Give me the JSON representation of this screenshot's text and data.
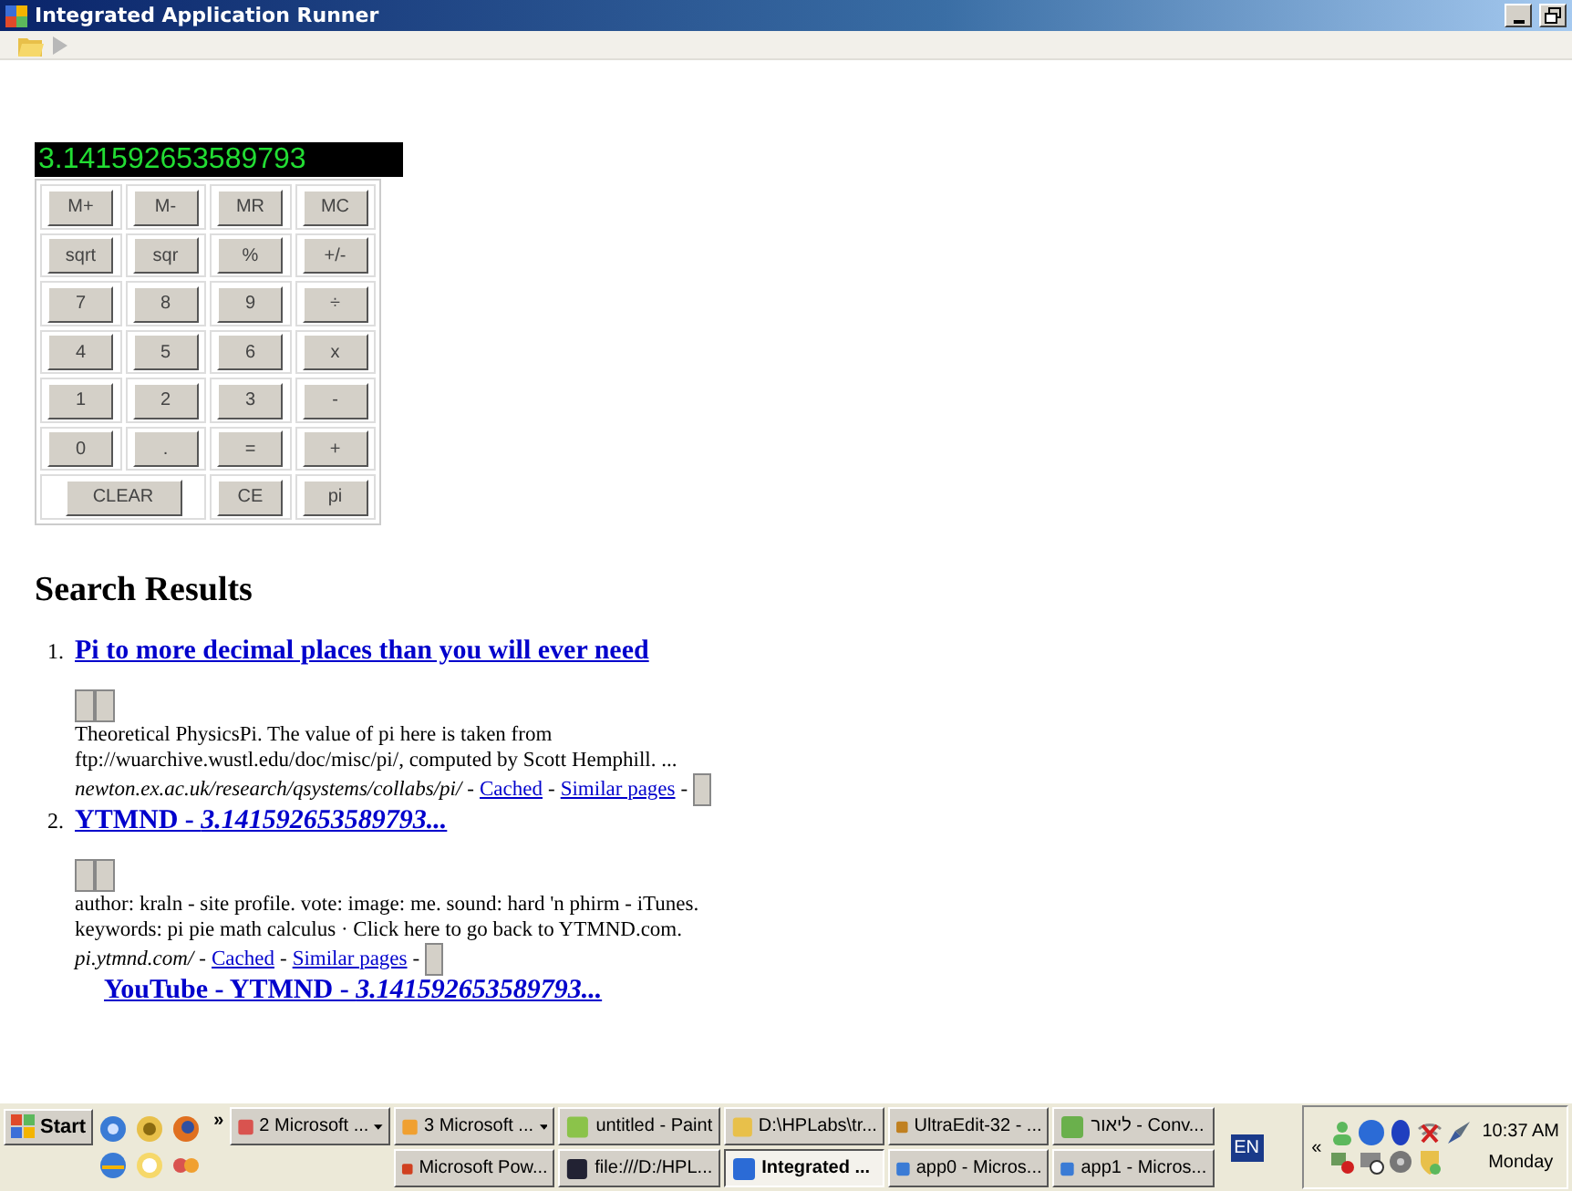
{
  "window": {
    "title": "Integrated Application Runner"
  },
  "calculator": {
    "display": "3.141592653589793",
    "rows": [
      [
        {
          "label": "M+",
          "kind": "key"
        },
        {
          "label": "M-",
          "kind": "key"
        },
        {
          "label": "MR",
          "kind": "key"
        },
        {
          "label": "MC",
          "kind": "key"
        }
      ],
      [
        {
          "label": "sqrt",
          "kind": "key"
        },
        {
          "label": "sqr",
          "kind": "key"
        },
        {
          "label": "%",
          "kind": "key"
        },
        {
          "label": "+/-",
          "kind": "key"
        }
      ],
      [
        {
          "label": "7",
          "kind": "key"
        },
        {
          "label": "8",
          "kind": "key"
        },
        {
          "label": "9",
          "kind": "key"
        },
        {
          "label": "÷",
          "kind": "key"
        }
      ],
      [
        {
          "label": "4",
          "kind": "key"
        },
        {
          "label": "5",
          "kind": "key"
        },
        {
          "label": "6",
          "kind": "key"
        },
        {
          "label": "x",
          "kind": "key"
        }
      ],
      [
        {
          "label": "1",
          "kind": "key"
        },
        {
          "label": "2",
          "kind": "key"
        },
        {
          "label": "3",
          "kind": "key"
        },
        {
          "label": "-",
          "kind": "key"
        }
      ],
      [
        {
          "label": "0",
          "kind": "key"
        },
        {
          "label": ".",
          "kind": "key"
        },
        {
          "label": "=",
          "kind": "key"
        },
        {
          "label": "+",
          "kind": "key"
        }
      ],
      [
        {
          "label": "CLEAR",
          "kind": "wide",
          "colspan": 2
        },
        {
          "label": "CE",
          "kind": "key"
        },
        {
          "label": "pi",
          "kind": "key"
        }
      ]
    ]
  },
  "search": {
    "heading": "Search Results",
    "results": [
      {
        "number": "1.",
        "title": "Pi to more decimal places than you will ever need",
        "snippet": "Theoretical PhysicsPi. The value of pi here is taken from ftp://wuarchive.wustl.edu/doc/misc/pi/, computed by Scott Hemphill. ...",
        "url": "newton.ex.ac.uk/research/qsystems/collabs/pi/",
        "meta": [
          {
            "kind": "dash",
            "text": "-"
          },
          {
            "kind": "link",
            "text": "Cached"
          },
          {
            "kind": "dash",
            "text": "-"
          },
          {
            "kind": "link",
            "text": "Similar pages"
          },
          {
            "kind": "dash",
            "text": "-"
          }
        ]
      },
      {
        "number": "2.",
        "title": "YTMND - *3.141592653589793...*",
        "snippet": "author: kraln - site profile. vote: image: me. sound: hard 'n phirm - iTunes. keywords: pi pie math calculus · Click here to go back to YTMND.com.",
        "url": "pi.ytmnd.com/",
        "meta": [
          {
            "kind": "dash",
            "text": "-"
          },
          {
            "kind": "link",
            "text": "Cached"
          },
          {
            "kind": "dash",
            "text": "-"
          },
          {
            "kind": "link",
            "text": "Similar pages"
          },
          {
            "kind": "dash",
            "text": "-"
          }
        ]
      },
      {
        "title": "YouTube - YTMND - *3.141592653589793...*"
      }
    ]
  },
  "taskbar": {
    "start": "Start",
    "more": "»",
    "tasks": [
      {
        "label": "2 Microsoft ...",
        "kind": "group",
        "selected": false
      },
      {
        "label": "3 Microsoft ...",
        "kind": "group",
        "selected": false
      },
      {
        "label": "untitled - Paint",
        "kind": "window",
        "selected": false
      },
      {
        "label": "D:\\HPLabs\\tr...",
        "kind": "window",
        "selected": false
      },
      {
        "label": "UltraEdit-32 - ...",
        "kind": "window",
        "selected": false
      },
      {
        "label": "ליאור - Conv...",
        "kind": "window",
        "selected": false
      },
      {
        "label": "Microsoft Pow...",
        "kind": "window",
        "selected": false
      },
      {
        "label": "file:///D:/HPL...",
        "kind": "window",
        "selected": false
      },
      {
        "label": "Integrated ...",
        "kind": "window",
        "selected": true
      },
      {
        "label": "app0 - Micros...",
        "kind": "window",
        "selected": false
      },
      {
        "label": "app1 - Micros...",
        "kind": "window",
        "selected": false
      }
    ],
    "language": "EN",
    "tray_expand": "«",
    "time": "10:37 AM",
    "day": "Monday"
  }
}
